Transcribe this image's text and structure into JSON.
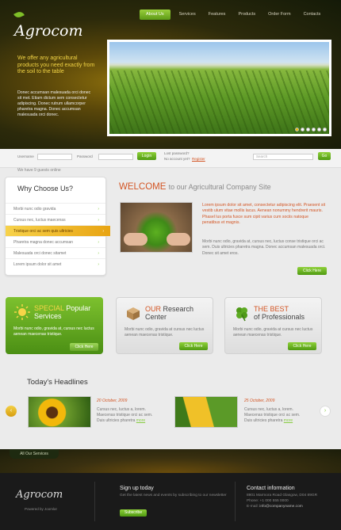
{
  "header": {
    "logo": "Agrocom",
    "nav": [
      "About Us",
      "Services",
      "Features",
      "Products",
      "Order Form",
      "Contacts"
    ],
    "hero_title": "We offer any agricultural products you need exactly from the soil to the table",
    "hero_text": "Donec accumsan malesuada orci donec sit met. Etiam dictum sem consectetur adipiscing. Donec rutrum ullamcorper pharetra magna. Donec accumsan malesuada orci donec.",
    "slider_dots": 6
  },
  "login": {
    "username_label": "Username",
    "password_label": "Password",
    "login_button": "Login",
    "lost_password": "Lost password?",
    "no_account": "No account yet?",
    "register": "Register",
    "search_placeholder": "Search",
    "go_button": "Go"
  },
  "guests_text": "We have 9 guests online",
  "why": {
    "title": "Why Choose Us?",
    "items": [
      "Morbi nunc odio gravida",
      "Cursus nec, luctus maecenas",
      "Tristique orci ac sem quis ultricies",
      "Pharetra magna donec accumsan",
      "Malesuada orci donec sitamet",
      "Lorem ipsum dolor sit amet"
    ],
    "active_index": 2
  },
  "welcome": {
    "title_highlight": "WELCOME",
    "title_rest": "to our Agricultural Company Site",
    "red_text": "Lorem ipsum dolor sit amet, consectetur adipiscing elit. Praesent sit vestib ulum vitae mollis lacus. Aenean nonummy hendrerit mauris. Phasel lus porta fusce sum cipit varius cum sociis natoque penatibus et magnis.",
    "body_text": "Morbi nunc odio, gravida at, cursus nec, luctus conse tristique orci ac sem. Duis ultricies pharetra magna. Donec accumsan malesuada orci. Donec sit amet eros.",
    "button": "Click Here"
  },
  "features": [
    {
      "title_a": "SPECIAL",
      "title_b": "Popular",
      "title_c": "Services",
      "text": "Morbi nunc odio, gravida at, cursus nec luctus aenean maecenas tristique.",
      "button": "Click Here"
    },
    {
      "title_a": "OUR",
      "title_b": "Research",
      "title_c": "Center",
      "text": "Morbi nunc odio, gravida at cursus nec luctus aenean maecenas tristique.",
      "button": "Click Here"
    },
    {
      "title_a": "THE BEST",
      "title_b": "",
      "title_c": "of Professionals",
      "text": "Morbi nunc odio, gravida at cursus nec luctus aenean maecenas tristique.",
      "button": "Click Here"
    }
  ],
  "headlines": {
    "title": "Today's Headlines",
    "items": [
      {
        "date": "20 October, 2009",
        "text": "Cursus nec, luctus a, lorem. Maecenas tristique orci ac sem. Duis ultricies pharetra",
        "more": "more"
      },
      {
        "date": "25 October, 2009",
        "text": "Cursus nec, luctus a, lorem. Maecenas tristique orci ac sem. Duis ultricies pharetra",
        "more": "more"
      }
    ]
  },
  "all_services": "All Our Services",
  "footer": {
    "logo": "Agrocom",
    "powered": "Powered by Joomla!",
    "signup_title": "Sign up today",
    "signup_text": "Get the latest news and events by subscribing to our newsletter",
    "subscribe": "Subscribe",
    "contact_title": "Contact information",
    "address": "8901 Marmora Road Glasgow, D04 89GR",
    "phone": "Phone: +1 000 555 0000",
    "email_label": "E-mail:",
    "email": "info@companyname.com"
  },
  "colors": {
    "accent_green": "#6cb324",
    "accent_orange": "#d35524",
    "hero_yellow": "#f3d545"
  }
}
